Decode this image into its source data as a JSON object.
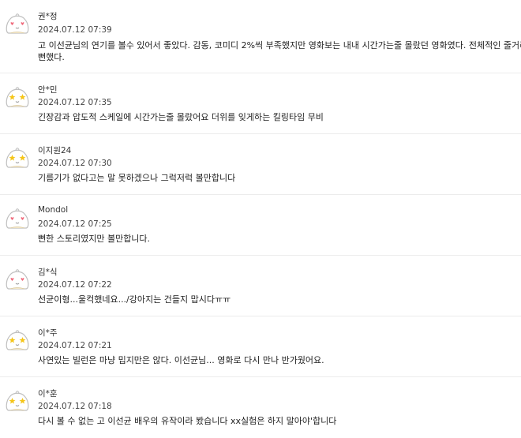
{
  "reviews": [
    {
      "avatar_icon": "heart-eyes-egg-avatar-icon",
      "nickname": "권*정",
      "date": "2024.07.12 07:39",
      "content_line1": "고 이선균님의 연기를 볼수 있어서 좋았다. 감동, 코미디 2%씩 부족했지만 영화보는 내내 시간가는줄 몰랐던 영화였다. 전체적인 줄거리는 조금",
      "content_line2": "뻔했다."
    },
    {
      "avatar_icon": "star-eyes-egg-avatar-icon",
      "nickname": "안*민",
      "date": "2024.07.12 07:35",
      "content": "긴장감과 압도적 스케일에 시간가는줄 몰랐어요 더위를 잊게하는 킬링타임 무비"
    },
    {
      "avatar_icon": "star-eyes-egg-avatar-icon",
      "nickname": "이지원24",
      "date": "2024.07.12 07:30",
      "content": "기름기가 없다고는 말 못하겠으나 그럭저럭 볼만합니다"
    },
    {
      "avatar_icon": "heart-eyes-egg-avatar-icon",
      "nickname": "Mondol",
      "date": "2024.07.12 07:25",
      "content": "뻔한 스토리였지만 볼만합니다."
    },
    {
      "avatar_icon": "heart-eyes-egg-avatar-icon",
      "nickname": "김*식",
      "date": "2024.07.12 07:22",
      "content": "선균이형...울컥했네요.../강아지는 건들지 맙시다ㅠㅠ"
    },
    {
      "avatar_icon": "star-eyes-egg-avatar-icon",
      "nickname": "이*주",
      "date": "2024.07.12 07:21",
      "content": "사연있는 빌런은 마냥 밉지만은 않다. 이선균님... 영화로 다시 만나 반가웠어요."
    },
    {
      "avatar_icon": "star-eyes-egg-avatar-icon",
      "nickname": "이*훈",
      "date": "2024.07.12 07:18",
      "content": "다시 볼 수 없는 고 이선균 배우의 유작이라 봤습니다 xx실험은 하지 말아야'합니다"
    }
  ],
  "colors": {
    "heart": "#f06b7d",
    "star": "#f5c518",
    "avatar_body": "#ffffff",
    "avatar_outline": "#bfbfbf"
  }
}
